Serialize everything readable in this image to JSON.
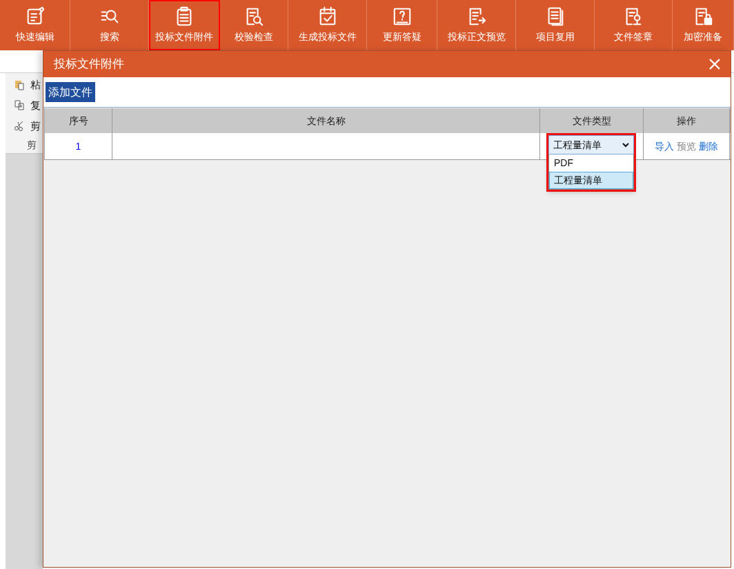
{
  "toolbar": {
    "items": [
      {
        "label": "快速编辑",
        "selected": false
      },
      {
        "label": "搜索",
        "selected": false
      },
      {
        "label": "投标文件附件",
        "selected": true
      },
      {
        "label": "校验检查",
        "selected": false
      },
      {
        "label": "生成投标文件",
        "selected": false
      },
      {
        "label": "更新答疑",
        "selected": false
      },
      {
        "label": "投标正文预览",
        "selected": false
      },
      {
        "label": "项目复用",
        "selected": false
      },
      {
        "label": "文件签章",
        "selected": false
      },
      {
        "label": "加密准备",
        "selected": false
      }
    ]
  },
  "clipboard_panel": {
    "items": [
      {
        "label": "粘"
      },
      {
        "label": "复"
      },
      {
        "label": "剪"
      }
    ],
    "group_label": "剪"
  },
  "dialog": {
    "title": "投标文件附件",
    "add_button": "添加文件",
    "table": {
      "columns": [
        "序号",
        "文件名称",
        "文件类型",
        "操作"
      ],
      "rows": [
        {
          "index": "1",
          "file_type": {
            "value": "工程量清单",
            "expanded": true,
            "options": [
              {
                "label": "PDF",
                "selected": false
              },
              {
                "label": "工程量清单",
                "selected": true
              }
            ]
          },
          "actions": [
            {
              "label": "导入",
              "disabled": false
            },
            {
              "label": "预览",
              "disabled": true
            },
            {
              "label": "删除",
              "disabled": false
            }
          ]
        }
      ]
    }
  }
}
